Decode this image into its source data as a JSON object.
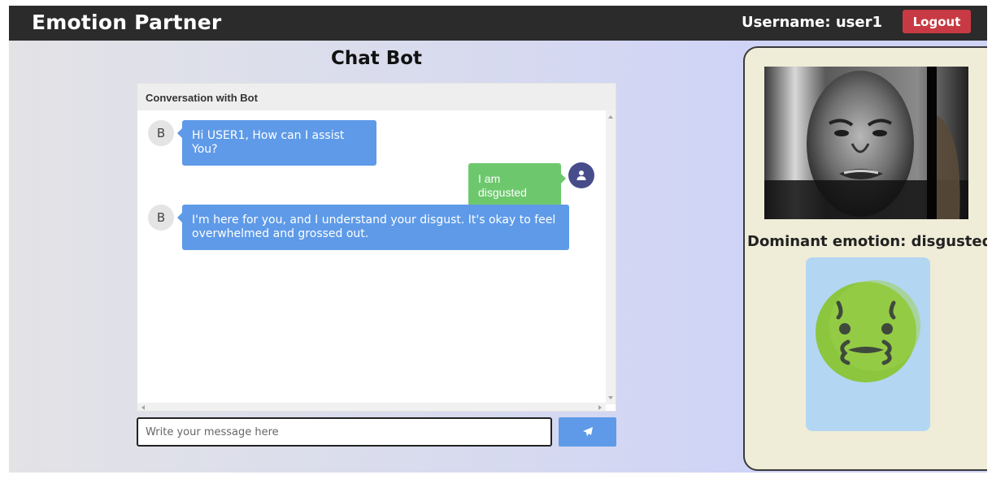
{
  "navbar": {
    "brand": "Emotion Partner",
    "username_label": "Username: user1",
    "logout_label": "Logout"
  },
  "chat": {
    "title": "Chat Bot",
    "header": "Conversation with Bot",
    "bot_initial": "B",
    "messages": [
      {
        "sender": "bot",
        "text": "Hi USER1, How can I assist You?"
      },
      {
        "sender": "user",
        "text": "I am disgusted"
      },
      {
        "sender": "bot",
        "text": "I'm here for you, and I understand your disgust. It's okay to feel overwhelmed and grossed out."
      }
    ],
    "input_placeholder": "Write your message here",
    "send_icon": "paper-plane-icon"
  },
  "emotion": {
    "label": "Dominant emotion: disgusted",
    "emoji": "nauseated-face-icon",
    "emoji_color": "#8cc63f",
    "card_color": "#b3d6f2"
  },
  "colors": {
    "navbar": "#2b2b2b",
    "logout": "#c83a43",
    "bot_bubble": "#5e9ae8",
    "user_bubble": "#6dc86d",
    "user_avatar": "#474c8a",
    "panel_bg": "#efecd8"
  }
}
